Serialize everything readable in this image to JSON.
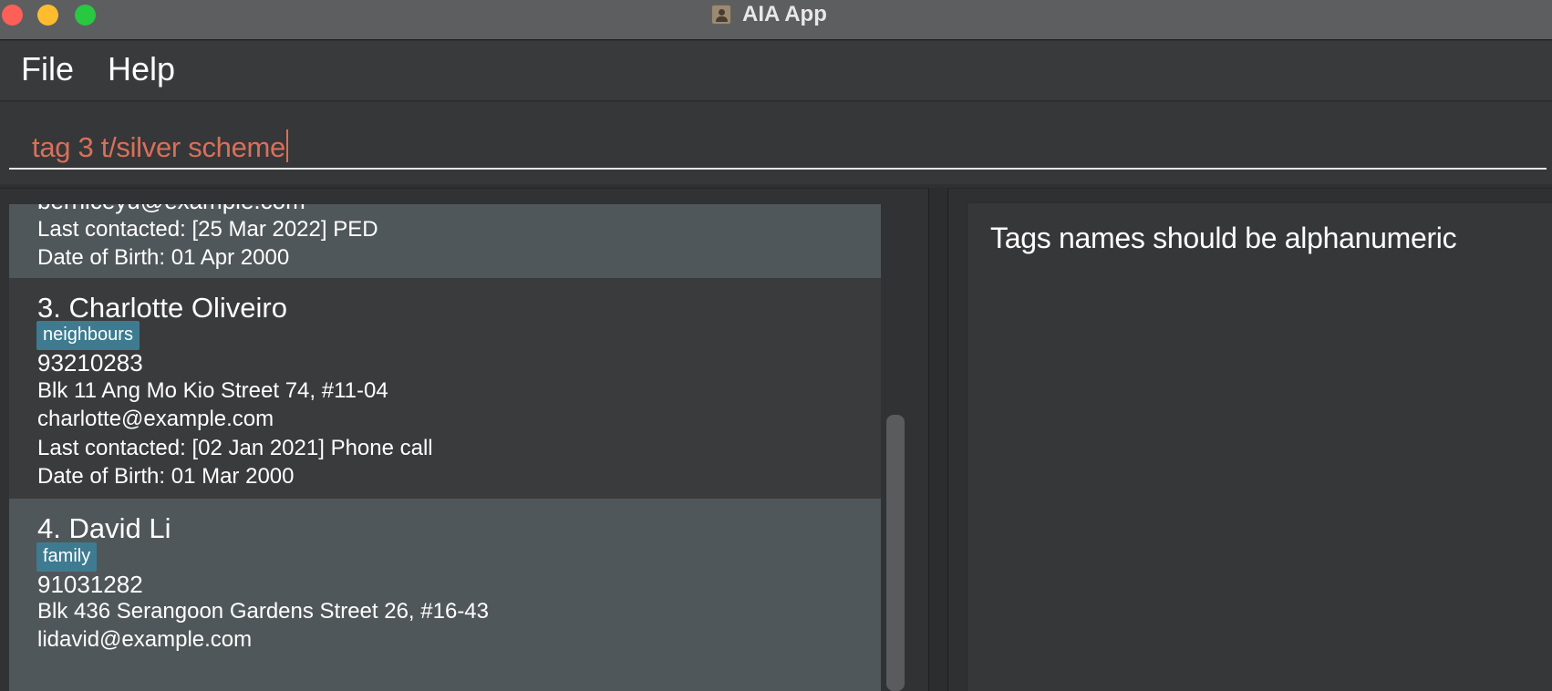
{
  "window": {
    "title": "AIA App",
    "icon": "contact-book-icon"
  },
  "menu": {
    "file_label": "File",
    "help_label": "Help"
  },
  "command": {
    "value": "tag 3 t/silver scheme",
    "text_color": "#d8705a"
  },
  "result": {
    "message": "Tags names should be alphanumeric"
  },
  "persons": [
    {
      "email": "berniceyu@example.com",
      "last_contacted": "Last contacted: [25 Mar 2022] PED",
      "dob": "Date of Birth: 01 Apr 2000"
    },
    {
      "name": "3.  Charlotte Oliveiro",
      "tag": "neighbours",
      "phone": "93210283",
      "address": "Blk 11 Ang Mo Kio Street 74, #11-04",
      "email": "charlotte@example.com",
      "last_contacted": "Last contacted: [02 Jan 2021] Phone call",
      "dob": "Date of Birth: 01 Mar 2000"
    },
    {
      "name": "4.  David Li",
      "tag": "family",
      "phone": "91031282",
      "address": "Blk 436 Serangoon Gardens Street 26, #16-43",
      "email": "lidavid@example.com"
    }
  ],
  "colors": {
    "tag_bg": "#3e7b91",
    "card_selected": "#50575b",
    "card_default": "#3a3b3c"
  }
}
